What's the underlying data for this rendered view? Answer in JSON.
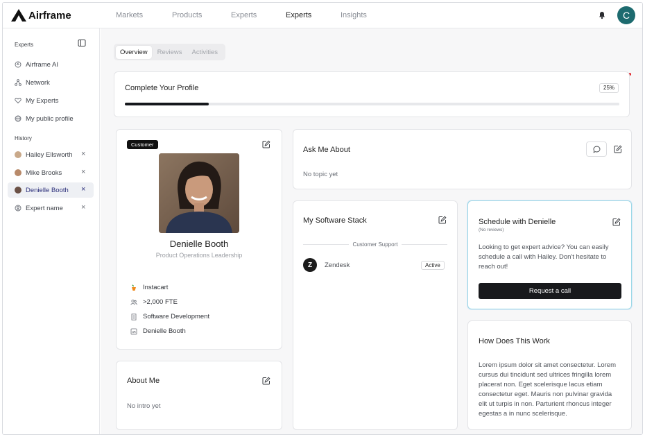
{
  "app": {
    "name": "Airframe"
  },
  "nav": {
    "items": [
      "Markets",
      "Products",
      "Experts",
      "Experts",
      "Insights"
    ],
    "active_index": 3
  },
  "user": {
    "initial": "C"
  },
  "sidebar": {
    "section1": "Experts",
    "items": [
      {
        "label": "Airframe AI",
        "icon": "sparkle-icon"
      },
      {
        "label": "Network",
        "icon": "network-icon"
      },
      {
        "label": "My Experts",
        "icon": "heart-icon"
      },
      {
        "label": "My public profile",
        "icon": "globe-icon"
      }
    ],
    "section2": "History",
    "history": [
      {
        "label": "Hailey Ellsworth"
      },
      {
        "label": "Mike Brooks"
      },
      {
        "label": "Denielle Booth",
        "selected": true
      },
      {
        "label": "Expert name"
      }
    ]
  },
  "tabs": [
    "Overview",
    "Reviews",
    "Activities"
  ],
  "profile_completion": {
    "title": "Complete Your Profile",
    "percent_label": "25%",
    "progress": 0.17
  },
  "profile": {
    "badge": "Customer",
    "name": "Denielle Booth",
    "role": "Product Operations Leadership",
    "details": [
      "Instacart",
      ">2,000 FTE",
      "Software Development",
      "Denielle Booth"
    ]
  },
  "about": {
    "title": "About Me",
    "empty": "No intro yet"
  },
  "ask": {
    "title": "Ask Me About",
    "empty": "No topic yet"
  },
  "stack": {
    "title": "My Software Stack",
    "category": "Customer Support",
    "tools": [
      {
        "name": "Zendesk",
        "status": "Active"
      }
    ]
  },
  "schedule": {
    "title": "Schedule with Denielle",
    "subtitle": "(No reviews)",
    "text": "Looking to get expert advice? You can easily schedule a call with Hailey. Don't hesitate to reach out!",
    "button": "Request a call"
  },
  "how": {
    "title": "How Does This Work",
    "text": "Lorem ipsum dolor sit amet consectetur. Lorem cursus dui tincidunt sed ultrices fringilla lorem placerat non. Eget scelerisque lacus etiam consectetur eget. Mauris non pulvinar gravida elit ut turpis in non. Parturient rhoncus integer egestas a in nunc scelerisque."
  },
  "colors": {
    "avatar_bg": "#1d6b6f",
    "accent_text": "#2c2f7a",
    "schedule_border": "#9cd9e6",
    "notification_dot": "#e0282e"
  }
}
